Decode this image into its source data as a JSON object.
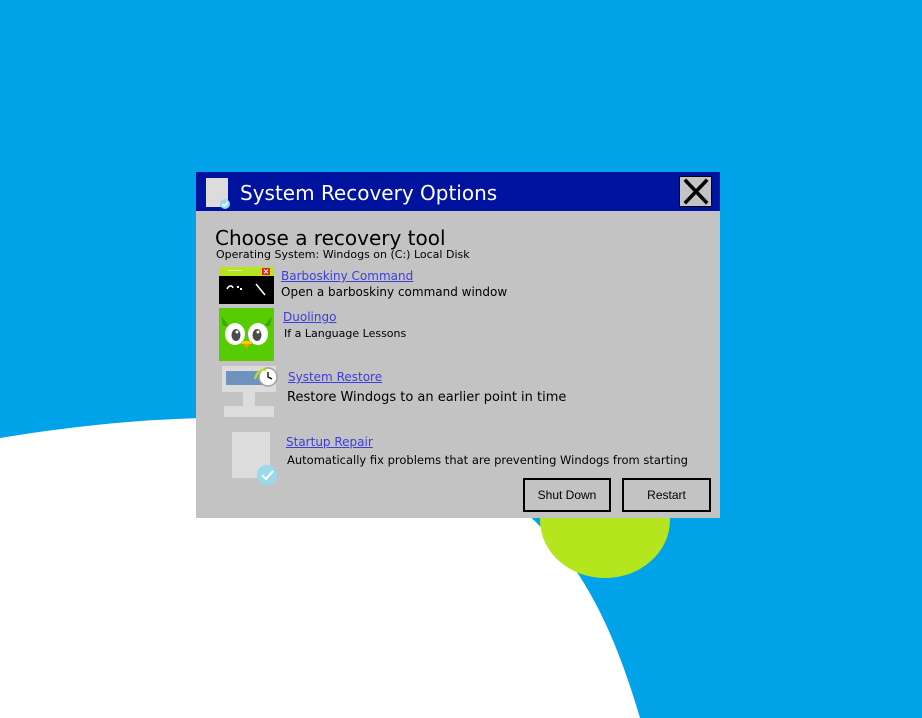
{
  "colors": {
    "desktop": "#00a2e8",
    "dialog": "#c3c3c3",
    "titlebar": "#00139e",
    "link": "#3d3dd9",
    "accent_green": "#b5e61d"
  },
  "window": {
    "title": "System Recovery Options",
    "title_icon": "document-check-icon",
    "close_icon": "close-icon"
  },
  "main": {
    "heading": "Choose a recovery tool",
    "os_line": "Operating System: Windogs on (C:) Local Disk"
  },
  "tools": [
    {
      "link": "Barboskiny Command",
      "description": "Open a barboskiny command window",
      "icon": "command-prompt-icon"
    },
    {
      "link": "Duolingo",
      "description": "If a Language Lessons",
      "icon": "duolingo-owl-icon"
    },
    {
      "link": "System Restore",
      "description": "Restore Windogs to an earlier point in time",
      "icon": "system-restore-icon"
    },
    {
      "link": "Startup Repair",
      "description": "Automatically fix problems that are preventing Windogs from starting",
      "icon": "startup-repair-icon"
    }
  ],
  "buttons": {
    "shutdown": "Shut Down",
    "restart": "Restart"
  }
}
